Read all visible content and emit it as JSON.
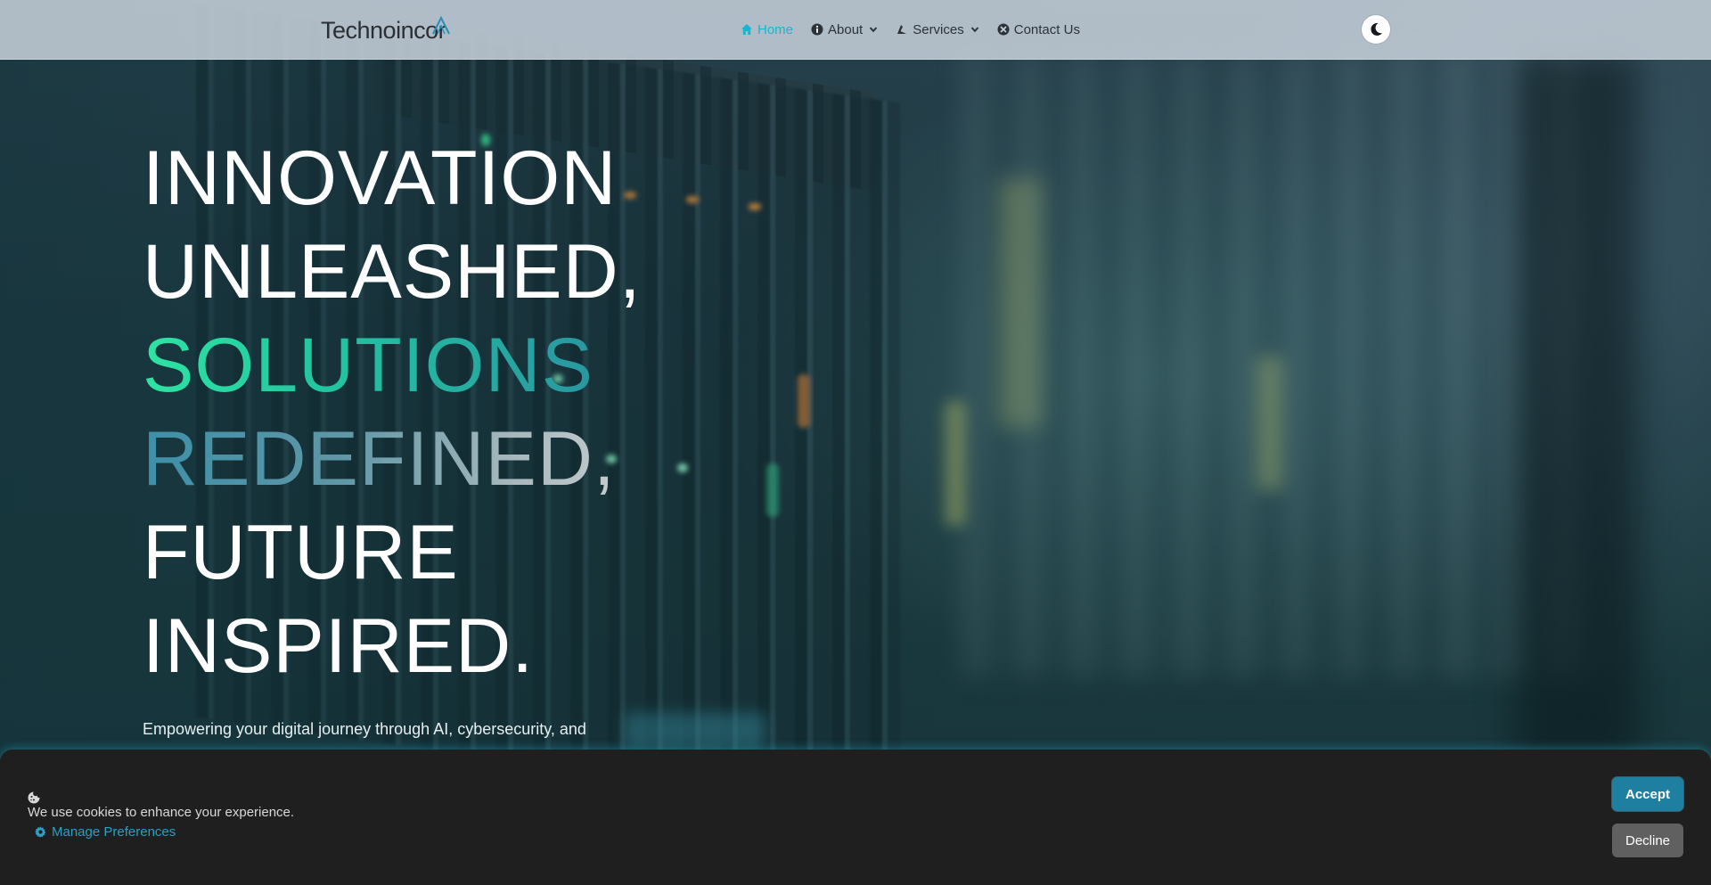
{
  "brand": {
    "logo_text": "Technoincor"
  },
  "nav": {
    "items": [
      {
        "label": "Home",
        "icon": "home-icon",
        "active": true,
        "has_dropdown": false
      },
      {
        "label": "About",
        "icon": "info-circle-icon",
        "active": false,
        "has_dropdown": true
      },
      {
        "label": "Services",
        "icon": "services-icon",
        "active": false,
        "has_dropdown": true
      },
      {
        "label": "Contact Us",
        "icon": "contact-icon",
        "active": false,
        "has_dropdown": false
      }
    ],
    "theme_toggle_icon": "moon-icon"
  },
  "hero": {
    "lines": [
      "INNOVATION",
      "UNLEASHED,",
      "SOLUTIONS",
      "REDEFINED,",
      "FUTURE",
      "INSPIRED."
    ],
    "subtitle": "Empowering your digital journey through AI, cybersecurity, and intelligent cloud solutions — crafted for businesses that aim higher."
  },
  "cookie_banner": {
    "icon": "cookie-icon",
    "message": "We use cookies to enhance your experience.",
    "manage_label": "Manage Preferences",
    "accept_label": "Accept",
    "decline_label": "Decline"
  },
  "colors": {
    "accent": "#17b6cf",
    "nav_bg": "#c4ced8",
    "cookie_bg": "#1f1f1f",
    "accept_bg": "#1e7fa0",
    "decline_bg": "#606060"
  }
}
